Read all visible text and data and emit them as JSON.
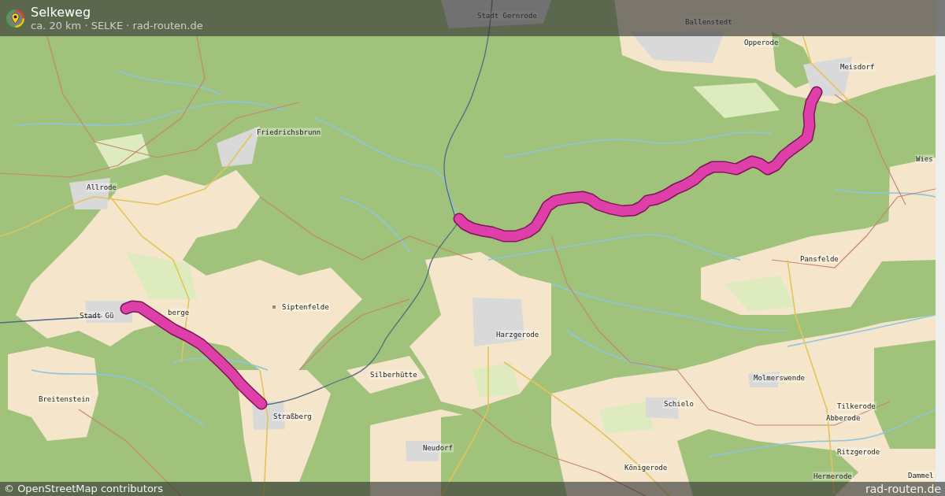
{
  "header": {
    "title": "Selkeweg",
    "subtitle": "ca. 20 km · SELKE · rad-routen.de"
  },
  "map": {
    "labels": [
      "Stadt Gernrode",
      "Ballenstedt",
      "Opperode",
      "Meisdorf",
      "Friedrichsbrunn",
      "Wies",
      "Allrode",
      "Pansfelde",
      "Siptenfelde",
      "Stadt Gü",
      "berge",
      "Harzgerode",
      "Silberhütte",
      "Molmerswende",
      "Breitenstein",
      "Schielo",
      "Tilkerode",
      "Straßberg",
      "Abberode",
      "Neudorf",
      "Ritzgerode",
      "Königerode",
      "Hermerode",
      "Dammel"
    ]
  },
  "footer": {
    "attribution": "© OpenStreetMap contributors",
    "credit": "rad-routen.de"
  }
}
